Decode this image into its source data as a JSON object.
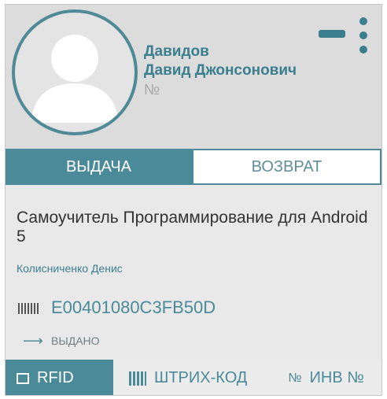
{
  "user": {
    "last_name": "Давидов",
    "full_name": "Давид Джонсонович",
    "number_label": "№"
  },
  "actions": {
    "minus_icon": "minus-icon",
    "more_icon": "vertical-dots-icon"
  },
  "tabs": [
    {
      "label": "ВЫДАЧА",
      "active": true
    },
    {
      "label": "ВОЗВРАТ",
      "active": false
    }
  ],
  "book": {
    "title": "Самоучитель Программирование для Android 5",
    "author": "Колисниченко Денис",
    "tag_id": "E00401080C3FB50D",
    "status": "ВЫДАНО"
  },
  "modes": [
    {
      "label": "RFID",
      "icon": "rfid-icon",
      "active": true
    },
    {
      "label": "ШТРИХ-КОД",
      "icon": "barcode-icon",
      "active": false
    },
    {
      "label": "ИНВ №",
      "icon": "number-sign-icon",
      "active": false
    }
  ],
  "colors": {
    "accent": "#4b8a98",
    "card_bg": "#e9e9e9",
    "header_bg": "#dcdcdc"
  }
}
